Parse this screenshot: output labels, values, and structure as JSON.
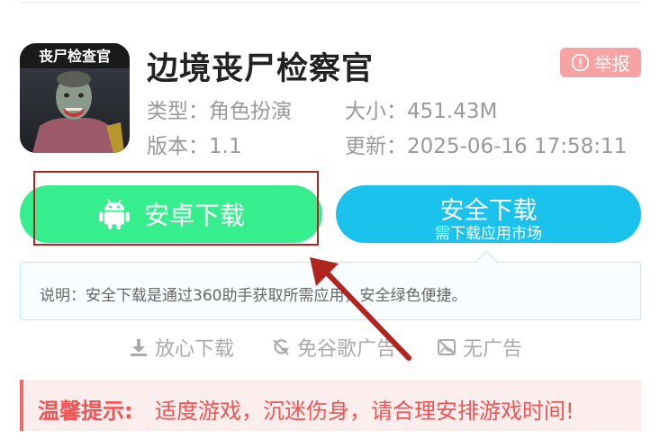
{
  "app": {
    "title": "边境丧尸检察官",
    "icon_banner": "丧尸检查官",
    "report_label": "举报",
    "type_text": "类型：角色扮演",
    "size_text": "大小：451.43M",
    "version_text": "版本：1.1",
    "updated_text": "更新：2025-06-16 17:58:11"
  },
  "downloads": {
    "android_label": "安卓下载",
    "safe_label": "安全下载",
    "safe_sublabel": "需下载应用市场"
  },
  "note": {
    "text": "说明：安全下载是通过360助手获取所需应用，安全绿色便捷。"
  },
  "features": [
    {
      "label": "放心下载",
      "icon": "download-icon"
    },
    {
      "label": "免谷歌广告",
      "icon": "no-google-ads-icon"
    },
    {
      "label": "无广告",
      "icon": "no-image-ads-icon"
    }
  ],
  "tip": {
    "label": "温馨提示:",
    "text": "适度游戏，沉迷伤身，请合理安排游戏时间!"
  },
  "colors": {
    "android_button": "#37ee8f",
    "safe_button": "#1bc3ec",
    "report_button": "#f7a3a3",
    "annotation_red": "#b1251f",
    "tip_text": "#f05454"
  }
}
